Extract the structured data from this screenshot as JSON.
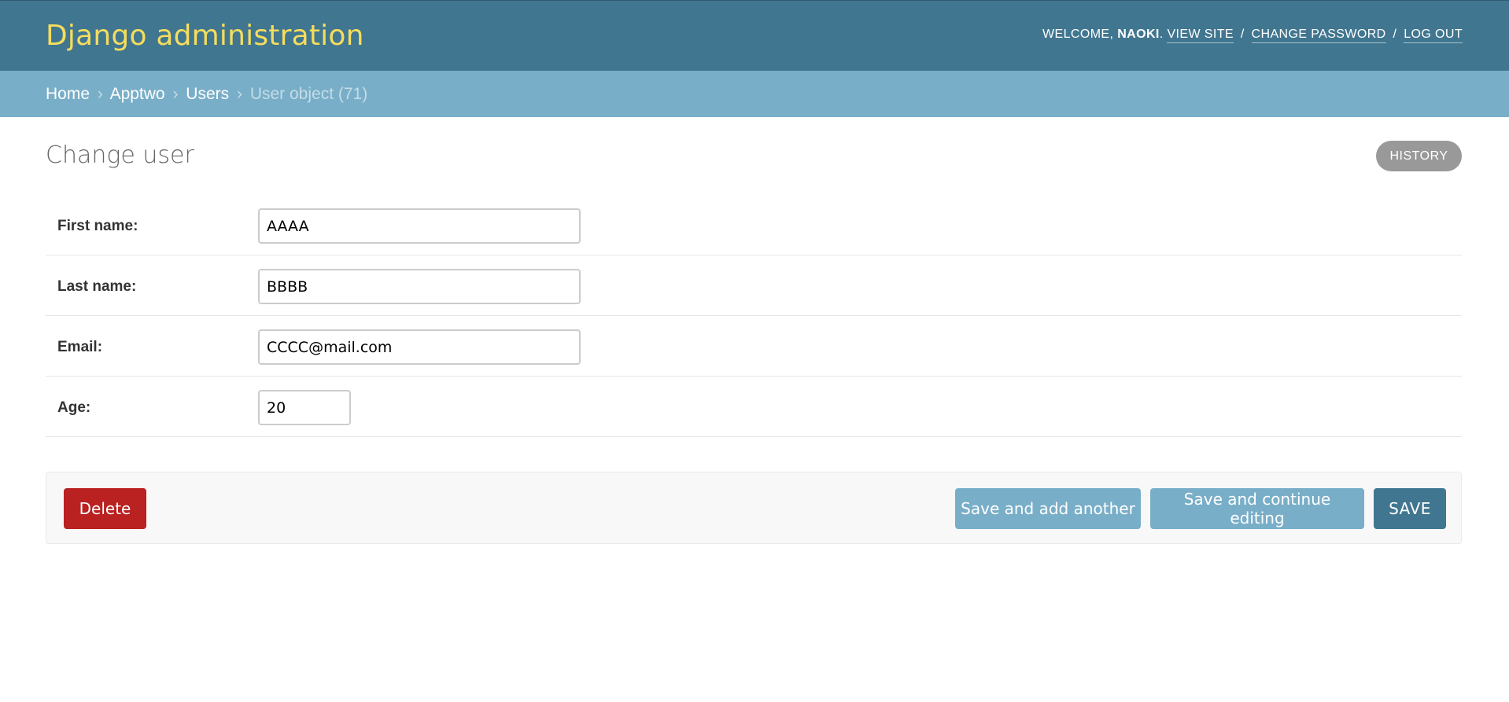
{
  "header": {
    "brand": "Django administration",
    "welcome_text": "WELCOME, ",
    "username": "NAOKI",
    "after_username": ". ",
    "view_site": "VIEW SITE",
    "change_password": "CHANGE PASSWORD",
    "log_out": "LOG OUT",
    "separator": "/"
  },
  "breadcrumbs": {
    "items": [
      "Home",
      "Apptwo",
      "Users"
    ],
    "current": "User object (71)",
    "separator": "›"
  },
  "content": {
    "title": "Change user",
    "history_label": "HISTORY"
  },
  "form": {
    "first_name": {
      "label": "First name:",
      "value": "AAAA"
    },
    "last_name": {
      "label": "Last name:",
      "value": "BBBB"
    },
    "email": {
      "label": "Email:",
      "value": "CCCC@mail.com"
    },
    "age": {
      "label": "Age:",
      "value": "20"
    }
  },
  "actions": {
    "delete_label": "Delete",
    "save_add_another_label": "Save and add another",
    "save_continue_label": "Save and continue editing",
    "save_label": "SAVE"
  },
  "colors": {
    "header_bg": "#417690",
    "brand_yellow": "#f5dd5d",
    "breadcrumb_bg": "#79aec8",
    "delete_red": "#ba2121",
    "secondary_button": "#79aec8",
    "primary_button": "#417690",
    "history_gray": "#999999"
  }
}
